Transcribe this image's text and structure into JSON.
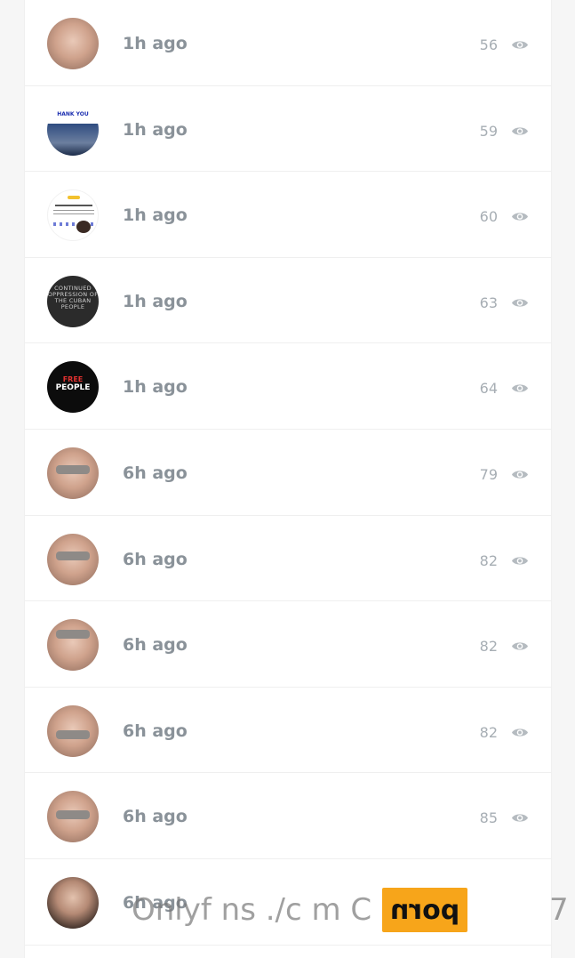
{
  "feed": {
    "items": [
      {
        "time": "1h ago",
        "views": "56",
        "thumb": "skin"
      },
      {
        "time": "1h ago",
        "views": "59",
        "thumb": "thankyou",
        "thumb_text": "HANK YOU"
      },
      {
        "time": "1h ago",
        "views": "60",
        "thumb": "donate",
        "thumb_text": "Your donation is pending"
      },
      {
        "time": "1h ago",
        "views": "63",
        "thumb": "dark",
        "thumb_text": "CONTINUED OPPRESSION OF THE CUBAN PEOPLE"
      },
      {
        "time": "1h ago",
        "views": "64",
        "thumb": "black",
        "thumb_text_1": "FREE",
        "thumb_text_2": "PEOPLE"
      },
      {
        "time": "6h ago",
        "views": "79",
        "thumb": "skin"
      },
      {
        "time": "6h ago",
        "views": "82",
        "thumb": "skin"
      },
      {
        "time": "6h ago",
        "views": "82",
        "thumb": "skin"
      },
      {
        "time": "6h ago",
        "views": "82",
        "thumb": "skin"
      },
      {
        "time": "6h ago",
        "views": "85",
        "thumb": "skin"
      },
      {
        "time": "6h ago",
        "views": "",
        "thumb": "skin"
      }
    ]
  },
  "watermark": {
    "text": "Onlyf ns ./c m C",
    "logo": "porn",
    "trailing": "7"
  },
  "colors": {
    "time_text": "#8a9299",
    "views_text": "#a7aeb4",
    "accent_logo": "#f7a51a"
  },
  "icons": {
    "views": "eye-icon"
  }
}
